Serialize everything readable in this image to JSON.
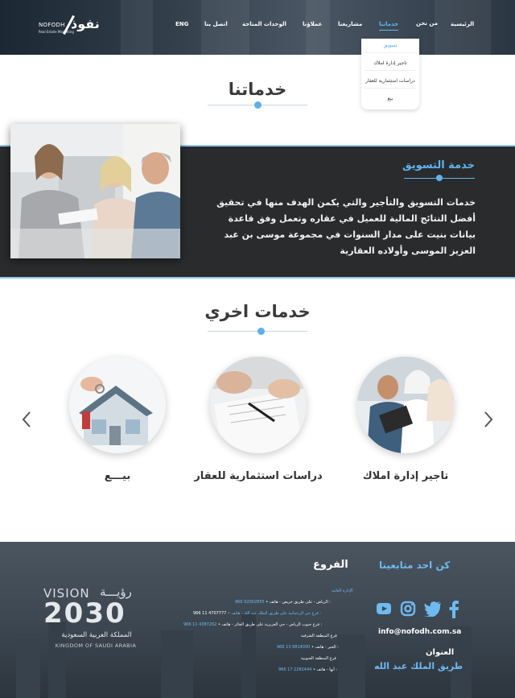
{
  "header": {
    "logo_en": "NOFODH",
    "logo_en_sub": "Real Estate Marketing",
    "logo_ar": "نفوذ",
    "nav": [
      {
        "id": "home",
        "label": "الرئيسية"
      },
      {
        "id": "about",
        "label": "من نحن"
      },
      {
        "id": "services",
        "label": "خدماتنا"
      },
      {
        "id": "projects",
        "label": "مشاريعنا"
      },
      {
        "id": "clients",
        "label": "عملاؤنا"
      },
      {
        "id": "units",
        "label": "الوحدات المتاحة"
      },
      {
        "id": "contact",
        "label": "اتصل بنا"
      },
      {
        "id": "lang",
        "label": "ENG"
      }
    ],
    "dropdown": [
      "تسويق",
      "تاجير إدارة املاك",
      "دراسات استثمارية للعقار",
      "بيع"
    ]
  },
  "services_title": "خدماتنا",
  "marketing": {
    "title": "خدمة التسويق",
    "text": "خدمات التسويق والتأجير والتي يكمن الهدف منها في تحقيق أفضل النتائج المالية للعميل في عقاره وتعمل وفق قاعدة بيانات بنيت على مدار السنوات في مجموعة موسى بن عبد العزيز الموسى وأولاده العقارية"
  },
  "other_title": "خدمات اخري",
  "carousel": {
    "prev_icon": "chevron-left-icon",
    "next_icon": "chevron-right-icon",
    "items": [
      "بيـــع",
      "دراسات استثمارية للعقار",
      "تاجير إدارة املاك"
    ]
  },
  "footer": {
    "branches_title": "الفروع",
    "follow_title": "كن احد متابعينا",
    "email": "info@nofodh.com.sa",
    "address_label": "العنوان",
    "address_value": "طريق الملك عبد الله",
    "head_office": "الإدارة العامة",
    "lines": [
      {
        "text": "• الرياض - على طريق خريص - هاتف :",
        "phone": "966 92002855"
      },
      {
        "text": "• فرع حي الرحمانية على طريق الملك عبد الله - هاتف :",
        "phone": "966 11 4707777"
      },
      {
        "text": "• فرع جنوب الرياض - حي العزيزية على طريق الحائر - هاتف :",
        "phone": "966 11 4387262"
      },
      {
        "text": "فرع المنطقة الشرقية",
        "phone": ""
      },
      {
        "text": "• الخبر - هاتف :",
        "phone": "966 13 8814000"
      },
      {
        "text": "فرع المنطقة الجنوبية",
        "phone": ""
      },
      {
        "text": "• أبها - هاتف :",
        "phone": "966 17 2282444"
      }
    ],
    "vision_en": "VISION",
    "vision_ar": "رؤيـــة",
    "vision_year": "2030",
    "vision_kingdom_ar": "المملكة العربية السعودية",
    "vision_kingdom_en": "KINGDOM OF SAUDI ARABIA"
  },
  "colors": {
    "accent": "#5fb3ef",
    "dark_band": "#2a2b2c",
    "footer": "#3c4650"
  }
}
